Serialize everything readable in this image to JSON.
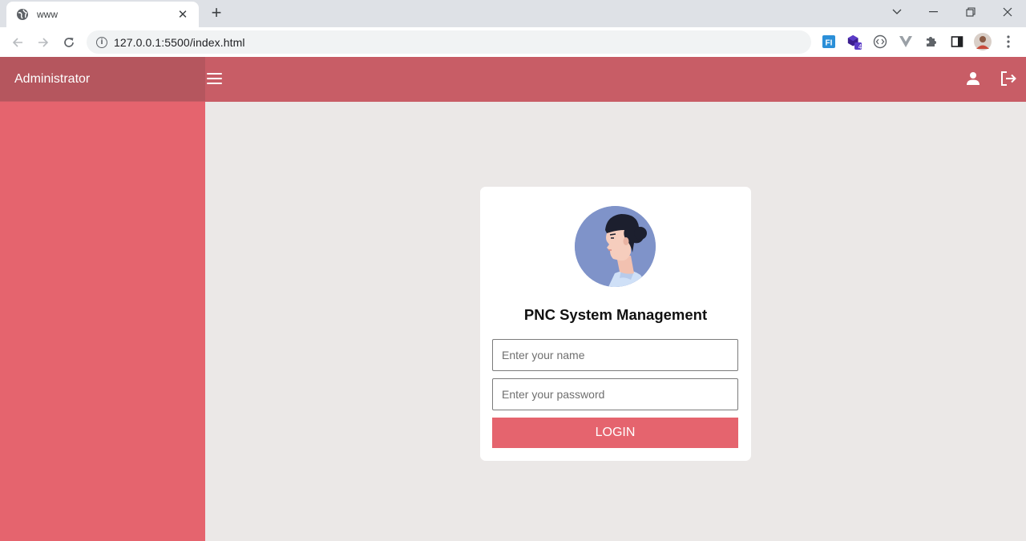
{
  "browser": {
    "tab_title": "www",
    "tab_icon": "globe-icon",
    "close_tab_glyph": "✕",
    "new_tab_glyph": "+",
    "url": "127.0.0.1:5500/index.html",
    "extension_badge": "4",
    "extension_fi_label": "FI"
  },
  "header": {
    "brand": "Administrator",
    "menu_icon": "hamburger-menu-icon",
    "user_icon": "user-icon",
    "logout_icon": "logout-icon"
  },
  "login": {
    "title": "PNC System Management",
    "name_placeholder": "Enter your name",
    "password_placeholder": "Enter your password",
    "button_label": "LOGIN"
  },
  "colors": {
    "sidebar": "#e5646e",
    "header": "#c85d66",
    "brand_bg": "#b5565e",
    "content_bg": "#ebe8e7",
    "button": "#e5646e",
    "avatar_bg": "#7f93c9"
  }
}
